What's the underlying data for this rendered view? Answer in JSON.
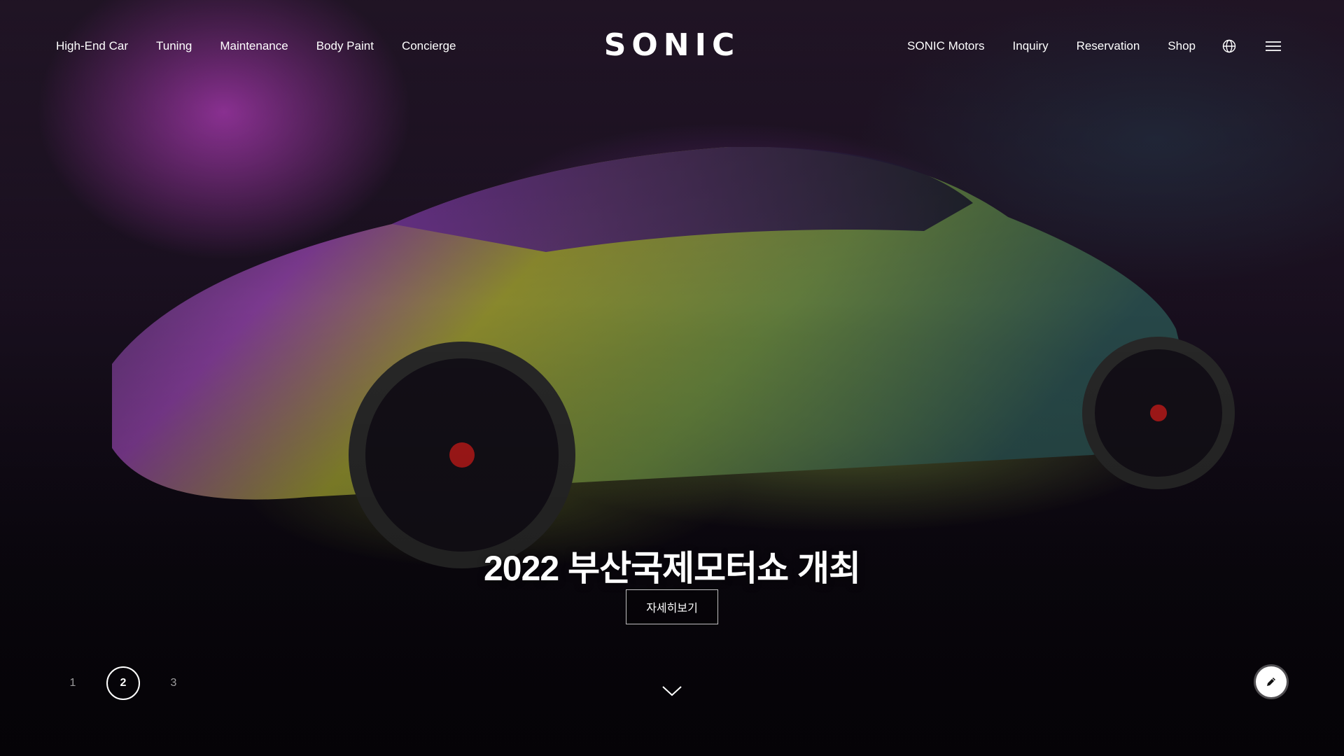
{
  "brand": {
    "logo_text": "SONIC"
  },
  "nav_left": [
    "High-End Car",
    "Tuning",
    "Maintenance",
    "Body Paint",
    "Concierge"
  ],
  "nav_right": [
    "SONIC Motors",
    "Inquiry",
    "Reservation",
    "Shop"
  ],
  "icons": {
    "globe": "globe-icon",
    "menu": "hamburger-menu-icon",
    "scroll": "chevron-down-icon",
    "edit": "pencil-icon"
  },
  "hero": {
    "headline": "2022 부산국제모터쇼 개최",
    "cta_label": "자세히보기"
  },
  "pager": {
    "pages": [
      "1",
      "2",
      "3"
    ],
    "active": "2"
  },
  "colors": {
    "accent_magenta": "#d246dc",
    "accent_green": "#8caa3c",
    "text": "#ffffff"
  }
}
